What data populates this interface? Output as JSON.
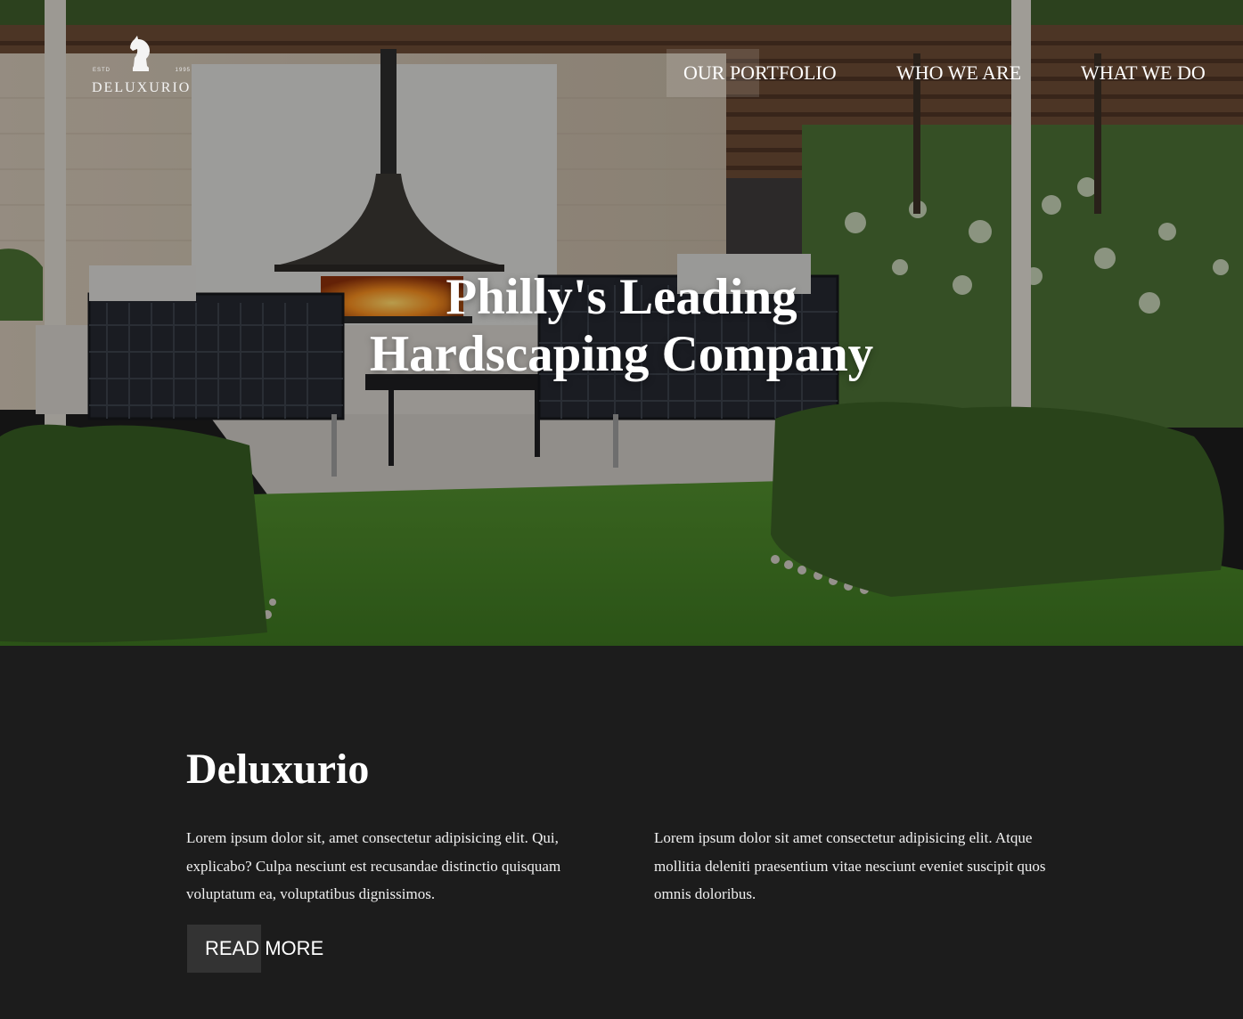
{
  "logo": {
    "estd": "ESTD",
    "year": "1995",
    "brand": "DELUXURIO"
  },
  "nav": {
    "items": [
      {
        "label": "OUR PORTFOLIO",
        "active": true
      },
      {
        "label": "WHO WE ARE",
        "active": false
      },
      {
        "label": "WHAT WE DO",
        "active": false
      }
    ]
  },
  "hero": {
    "title_line1": "Philly's Leading",
    "title_line2": "Hardscaping Company",
    "image": "garden-patio-fireplace-photo"
  },
  "about": {
    "heading": "Deluxurio",
    "paragraph1": "Lorem ipsum dolor sit, amet consectetur adipisicing elit. Qui, explicabo? Culpa nesciunt est recusandae distinctio quisquam voluptatum ea, voluptatibus dignissimos.",
    "paragraph2": "Lorem ipsum dolor sit amet consectetur adipisicing elit. Atque mollitia deleniti praesentium vitae nesciunt eveniet suscipit quos omnis doloribus.",
    "button_label": "READ MORE"
  },
  "colors": {
    "section_bg": "#1c1c1c",
    "button_bg": "#333333",
    "text": "#ffffff"
  }
}
